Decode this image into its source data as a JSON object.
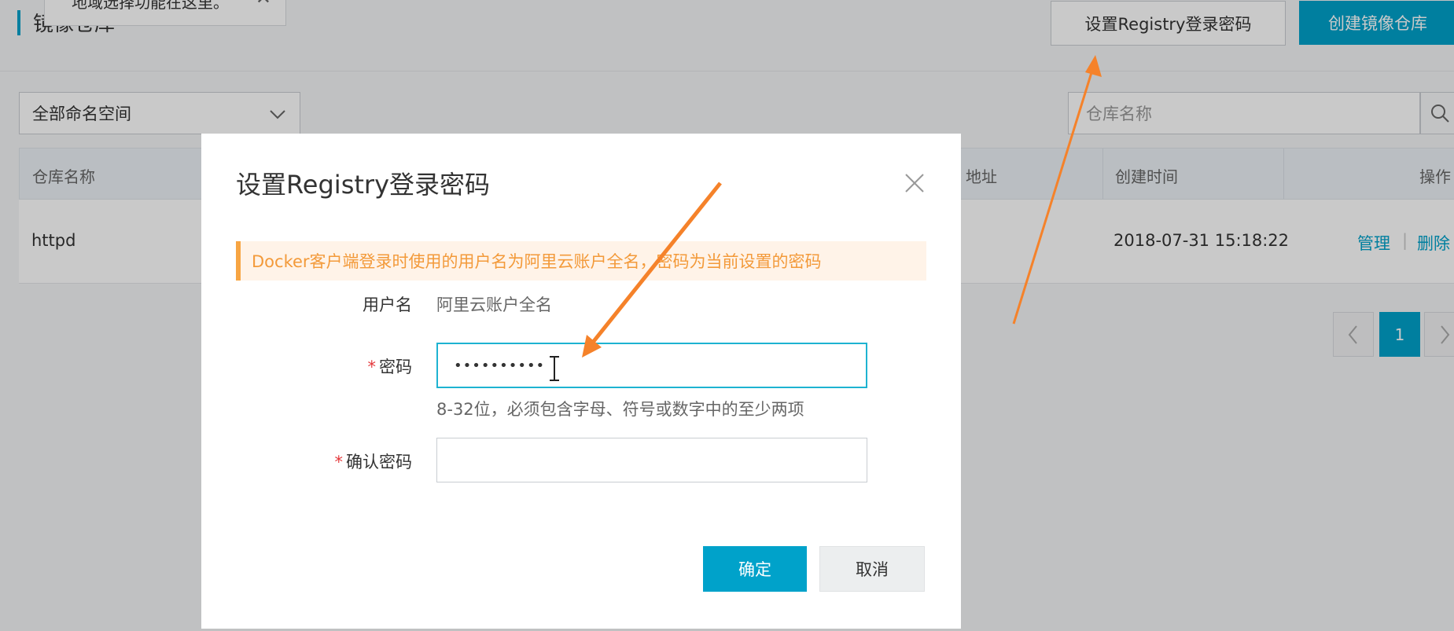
{
  "page": {
    "title": "镜像仓库",
    "toast_text": "地域选择功能在这里。",
    "set_password_button": "设置Registry登录密码",
    "create_repo_button": "创建镜像仓库",
    "namespace_select": "全部命名空间",
    "search_placeholder": "仓库名称"
  },
  "table": {
    "headers": [
      "仓库名称",
      "地址",
      "创建时间",
      "操作"
    ],
    "rows": [
      {
        "name": "httpd",
        "created": "2018-07-31 15:18:22",
        "manage": "管理",
        "delete": "删除"
      }
    ]
  },
  "pagination": {
    "current": "1"
  },
  "dialog": {
    "title": "设置Registry登录密码",
    "notice": "Docker客户端登录时使用的用户名为阿里云账户全名，密码为当前设置的密码",
    "username_label": "用户名",
    "username_value": "阿里云账户全名",
    "required_mark": "*",
    "password_label": "密码",
    "password_value": "••••••••••",
    "password_hint": "8-32位，必须包含字母、符号或数字中的至少两项",
    "confirm_label": "确认密码",
    "ok_button": "确定",
    "cancel_button": "取消"
  },
  "colors": {
    "accent": "#00a2ca",
    "annotation_arrow": "#f5822a",
    "notice_text": "#f39a3a"
  }
}
